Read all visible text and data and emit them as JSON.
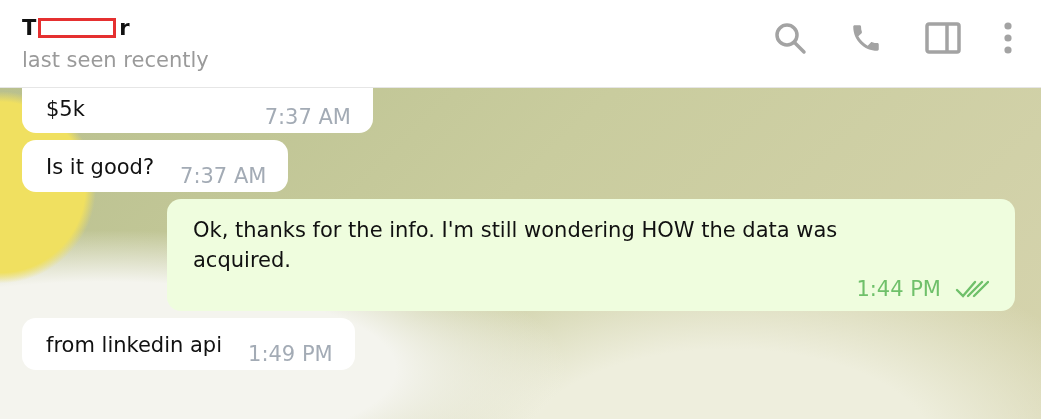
{
  "header": {
    "title_start": "T",
    "title_end": "r",
    "redacted": true,
    "status": "last seen recently"
  },
  "messages": [
    {
      "kind": "incoming",
      "text": "$5k",
      "time": "7:37 AM"
    },
    {
      "kind": "incoming",
      "text": "Is it good?",
      "time": "7:37 AM"
    },
    {
      "kind": "outgoing",
      "text": "Ok, thanks for the info. I'm still wondering HOW the data was acquired.",
      "time": "1:44 PM",
      "read": true
    },
    {
      "kind": "incoming",
      "text": "from linkedin api",
      "time": "1:49 PM"
    }
  ]
}
